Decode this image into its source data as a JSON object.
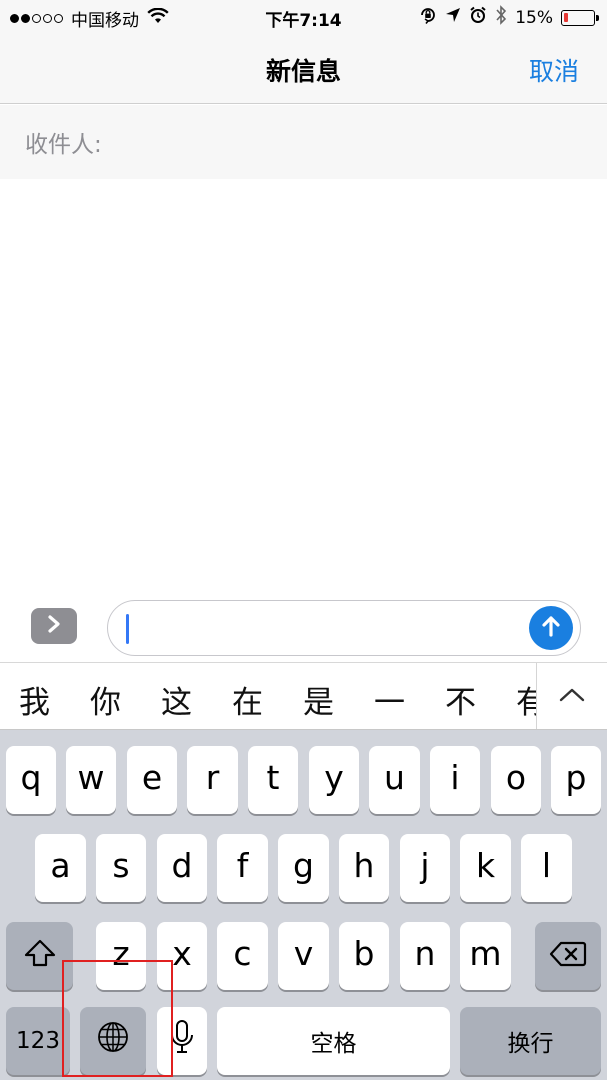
{
  "status_bar": {
    "signal_dots": [
      true,
      true,
      false,
      false,
      false
    ],
    "carrier": "中国移动",
    "time": "下午7:14",
    "battery_percent": "15%",
    "battery_level": 0.15,
    "icons": [
      "wifi-icon",
      "orientation-lock-icon",
      "location-icon",
      "alarm-icon",
      "bluetooth-icon",
      "battery-icon"
    ]
  },
  "nav": {
    "title": "新信息",
    "cancel": "取消"
  },
  "recipient": {
    "label": "收件人:"
  },
  "input_bar": {
    "expand_icon": "chevron-right-icon",
    "send_icon": "arrow-up-icon",
    "value": ""
  },
  "candidates": [
    "我",
    "你",
    "这",
    "在",
    "是",
    "一",
    "不",
    "有"
  ],
  "keyboard": {
    "row1": [
      "q",
      "w",
      "e",
      "r",
      "t",
      "y",
      "u",
      "i",
      "o",
      "p"
    ],
    "row2": [
      "a",
      "s",
      "d",
      "f",
      "g",
      "h",
      "j",
      "k",
      "l"
    ],
    "row3": [
      "z",
      "x",
      "c",
      "v",
      "b",
      "n",
      "m"
    ],
    "numbers": "123",
    "space": "空格",
    "return": "换行",
    "icons": [
      "shift-icon",
      "backspace-icon",
      "globe-icon",
      "microphone-icon"
    ]
  },
  "colors": {
    "accent": "#1a7fe0",
    "highlight": "#e02020",
    "battery_low": "#e53935"
  }
}
